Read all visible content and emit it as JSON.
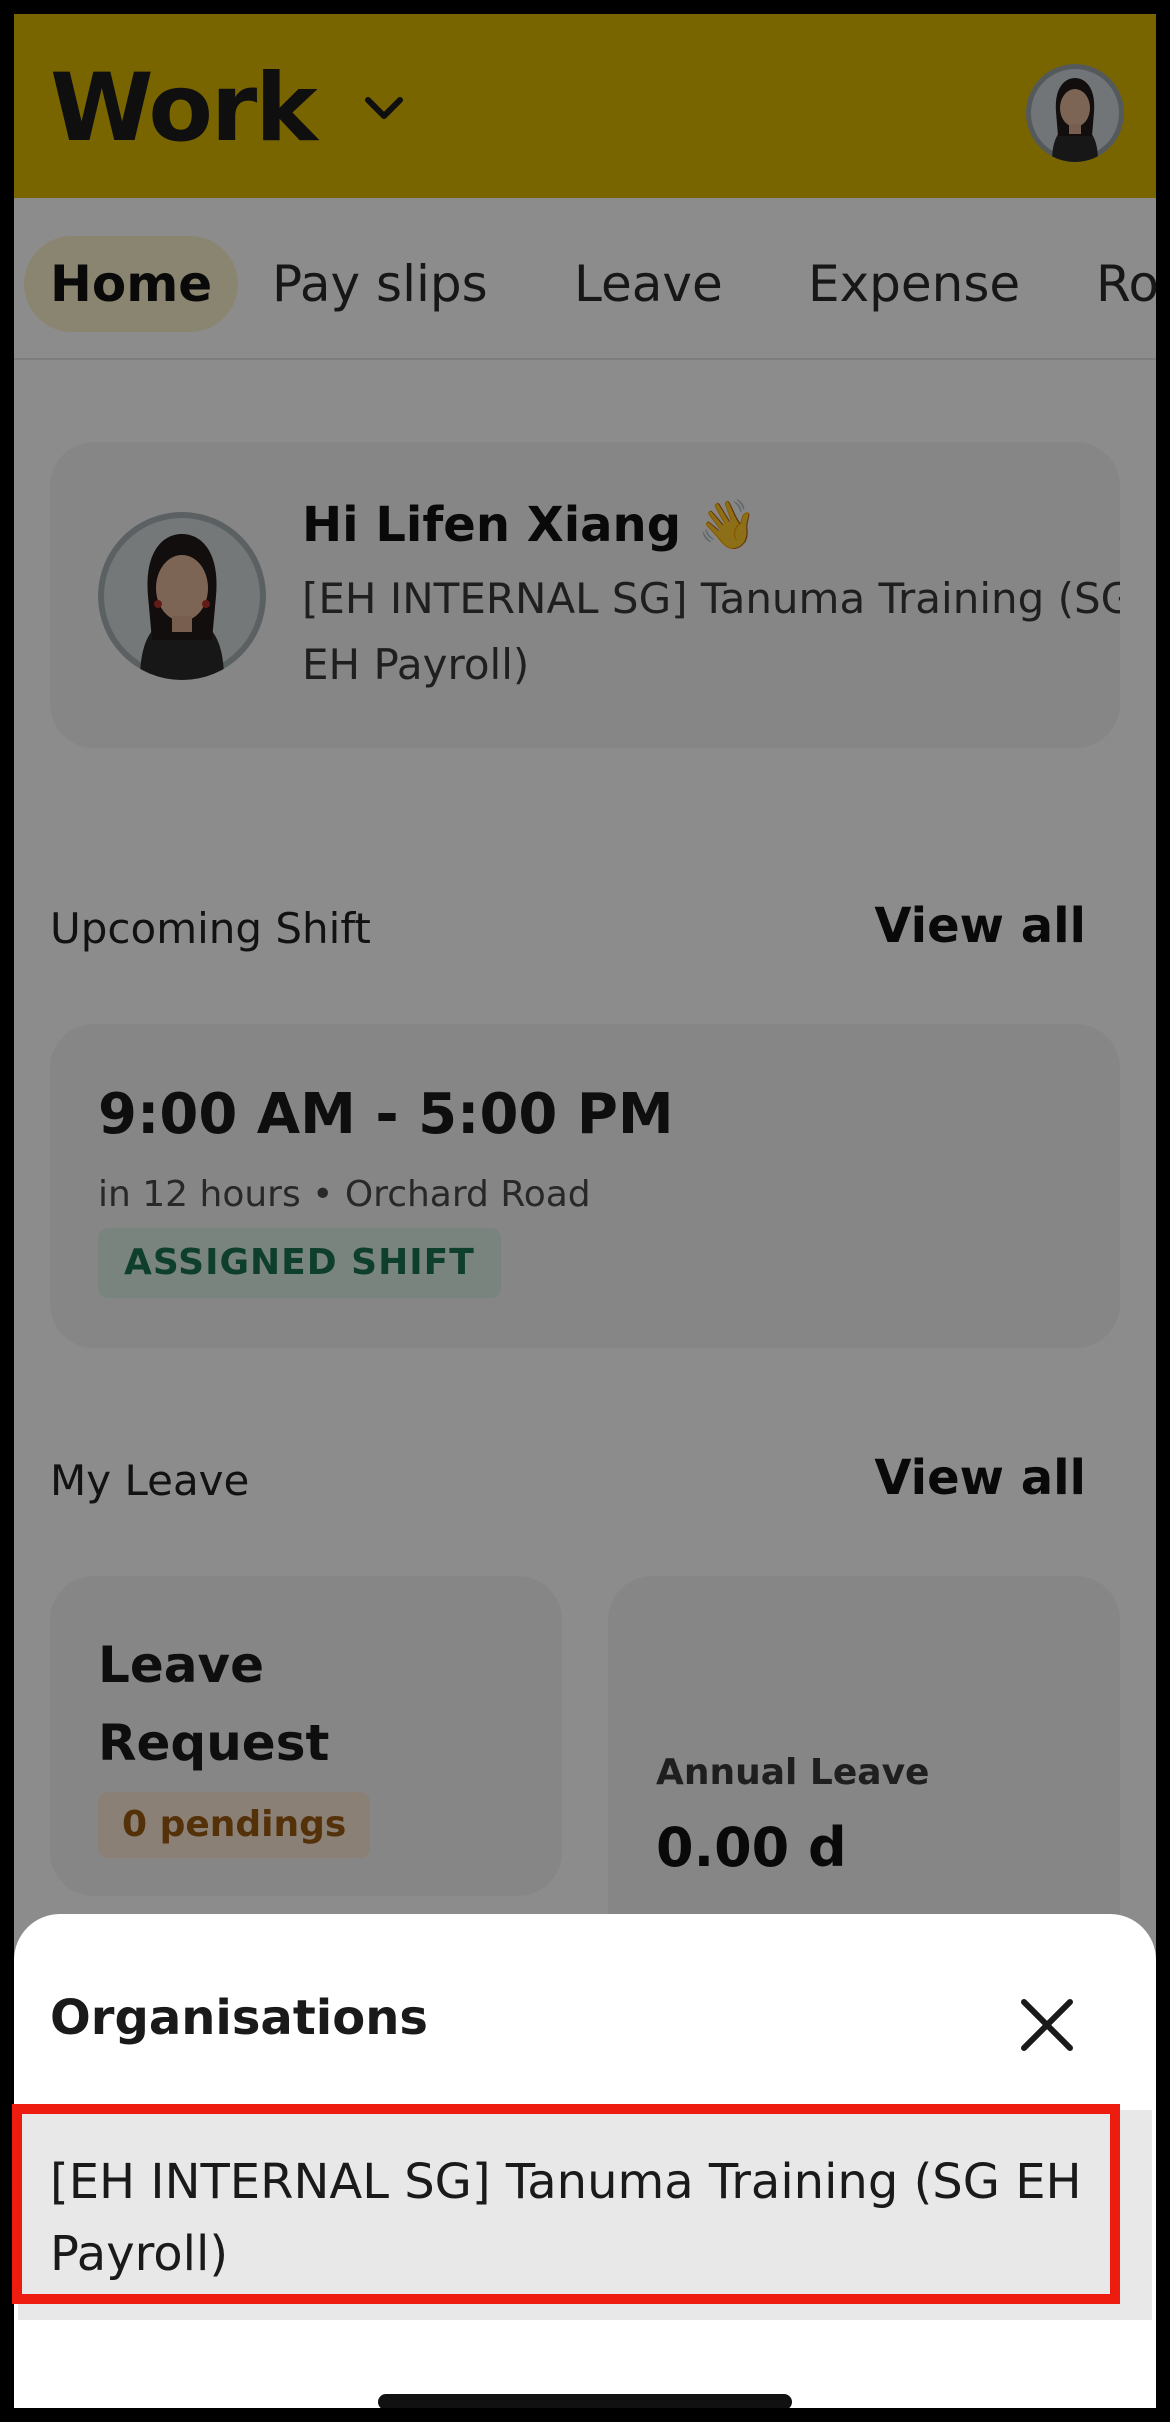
{
  "header": {
    "title": "Work",
    "bg_color": "#ddb800"
  },
  "tabs": [
    {
      "label": "Home",
      "active": true
    },
    {
      "label": "Pay slips",
      "active": false
    },
    {
      "label": "Leave",
      "active": false
    },
    {
      "label": "Expense",
      "active": false
    },
    {
      "label": "Ro",
      "active": false
    }
  ],
  "greeting": {
    "name": "Hi Lifen Xiang",
    "emoji": "👋",
    "org": "[EH INTERNAL SG] Tanuma Training (SG EH Payroll)"
  },
  "upcoming_shift": {
    "section_title": "Upcoming Shift",
    "view_all": "View all",
    "time": "9:00 AM - 5:00 PM",
    "meta": "in 12 hours • Orchard Road",
    "badge": "ASSIGNED SHIFT"
  },
  "my_leave": {
    "section_title": "My Leave",
    "view_all": "View all",
    "request_title": "Leave Request",
    "pending_badge": "0 pendings",
    "annual_label": "Annual Leave",
    "annual_value": "0.00 d"
  },
  "sheet": {
    "title": "Organisations",
    "close_icon": "close-icon",
    "organisations": [
      {
        "label": "[EH INTERNAL SG] Tanuma Training (SG EH Payroll)",
        "selected": true
      }
    ]
  },
  "colors": {
    "accent": "#ddb800",
    "highlight": "#ee1c0e",
    "badge_green": "#1a7150",
    "badge_orange": "#9a5a10"
  }
}
